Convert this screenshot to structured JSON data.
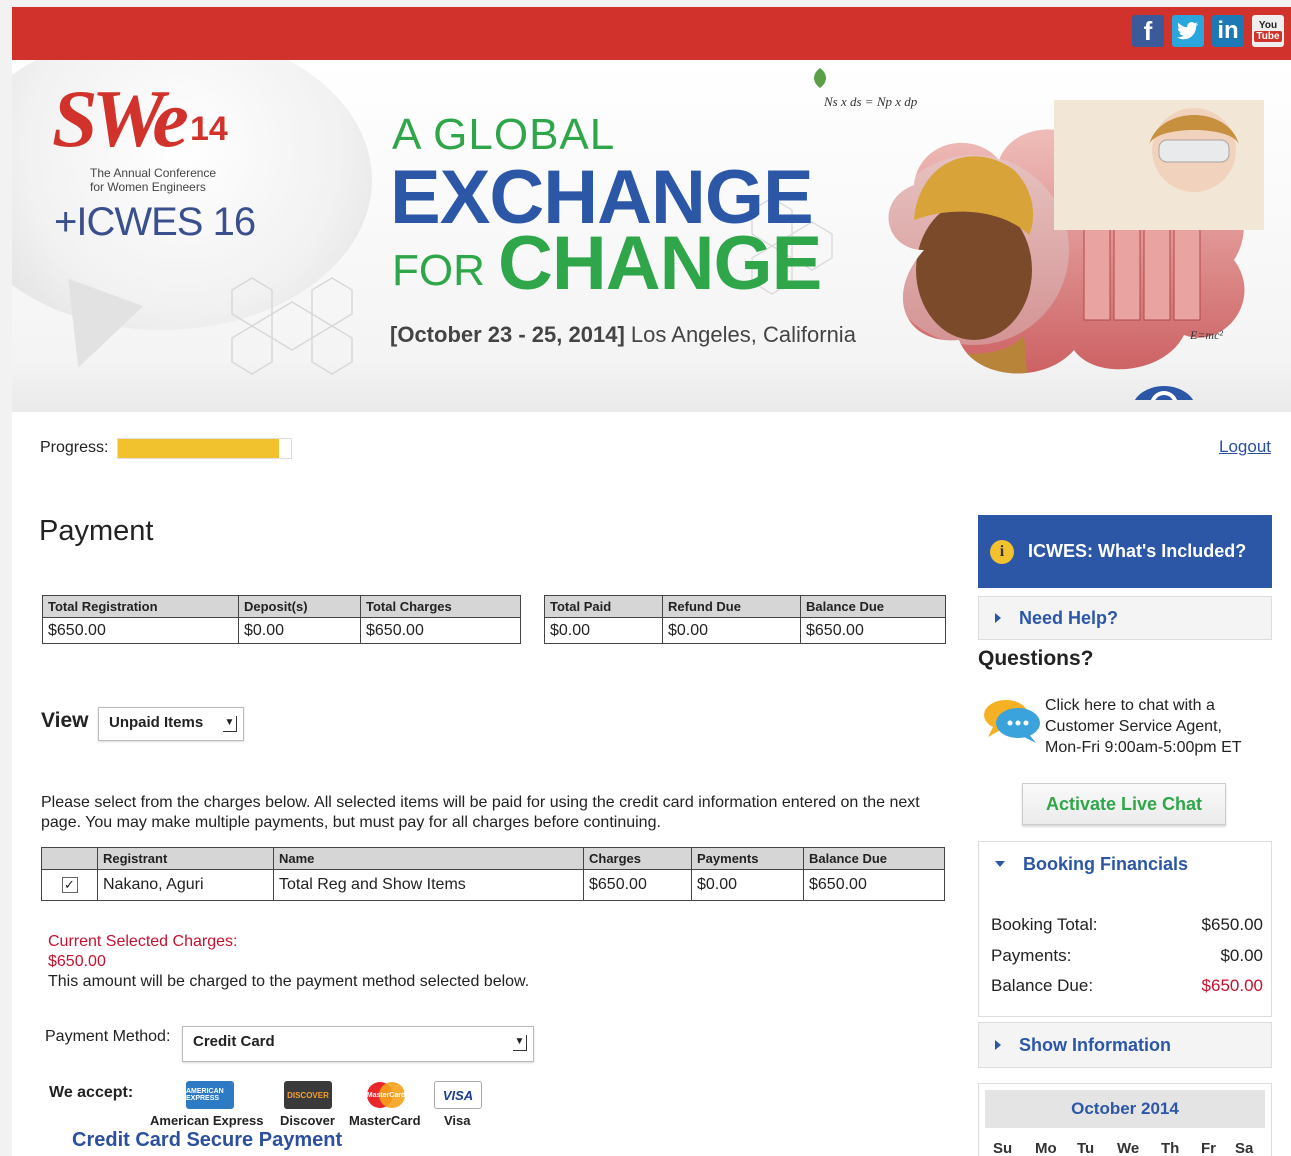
{
  "social": {
    "facebook": "f",
    "twitter": "t",
    "linkedin": "in",
    "youtube_top": "You",
    "youtube_bottom": "Tube"
  },
  "banner": {
    "logo_swe": "SWe",
    "logo_14": "14",
    "logo_sub_1": "The Annual Conference",
    "logo_sub_2": "for Women Engineers",
    "logo_icwes": "+ICWES 16",
    "headline_1": "A GLOBAL",
    "headline_2": "EXCHANGE",
    "headline_3": "FOR",
    "headline_4": "CHANGE",
    "dates": "[October 23 - 25, 2014]",
    "location": "Los Angeles, California",
    "formula_1": "Ns x ds = Np x dp",
    "formula_2": "E=mc²"
  },
  "progress": {
    "label": "Progress:",
    "fraction": 0.93
  },
  "logout": "Logout",
  "payment": {
    "title": "Payment",
    "summary_left": {
      "headers": [
        "Total Registration",
        "Deposit(s)",
        "Total Charges"
      ],
      "values": [
        "$650.00",
        "$0.00",
        "$650.00"
      ]
    },
    "summary_right": {
      "headers": [
        "Total Paid",
        "Refund Due",
        "Balance Due"
      ],
      "values": [
        "$0.00",
        "$0.00",
        "$650.00"
      ]
    },
    "view_label": "View",
    "view_selected": "Unpaid Items",
    "instructions": "Please select from the charges below. All selected items will be paid for using the credit card information entered on the next page. You may make multiple payments, but must pay for all charges before continuing.",
    "items": {
      "headers": [
        "",
        "Registrant",
        "Name",
        "Charges",
        "Payments",
        "Balance Due"
      ],
      "rows": [
        {
          "checked": "✓",
          "registrant": "Nakano, Aguri",
          "name": "Total Reg and Show Items",
          "charges": "$650.00",
          "payments": "$0.00",
          "balance": "$650.00"
        }
      ]
    },
    "selected_label": "Current Selected Charges:",
    "selected_amount": "$650.00",
    "selected_note": "This amount will be charged to the payment method selected below.",
    "method_label": "Payment Method:",
    "method_selected": "Credit Card",
    "accept_label": "We accept:",
    "cards": [
      {
        "label": "American Express",
        "badge": "AMERICAN EXPRESS"
      },
      {
        "label": "Discover",
        "badge": "DISCOVER"
      },
      {
        "label": "MasterCard",
        "badge": "MasterCard"
      },
      {
        "label": "Visa",
        "badge": "VISA"
      }
    ],
    "secure_title": "Credit Card Secure Payment"
  },
  "sidebar": {
    "whats_included": "ICWES: What's Included?",
    "need_help": "Need Help?",
    "questions": "Questions?",
    "chat_text_1": "Click here to chat with a",
    "chat_text_2": "Customer Service Agent,",
    "chat_text_3": "Mon-Fri 9:00am-5:00pm ET",
    "live_chat": "Activate Live Chat",
    "financials": {
      "title": "Booking Financials",
      "rows": [
        {
          "label": "Booking Total:",
          "value": "$650.00"
        },
        {
          "label": "Payments:",
          "value": "$0.00"
        },
        {
          "label": "Balance Due:",
          "value": "$650.00"
        }
      ]
    },
    "show_info": "Show Information",
    "calendar": {
      "month": "October 2014",
      "days": [
        "Su",
        "Mo",
        "Tu",
        "We",
        "Th",
        "Fr",
        "Sa"
      ]
    }
  },
  "colors": {
    "brand_red": "#d1332c",
    "brand_blue": "#2c57a7",
    "brand_green": "#2fa64a",
    "alert_red": "#c8102e",
    "progress_yellow": "#f2c12e"
  }
}
